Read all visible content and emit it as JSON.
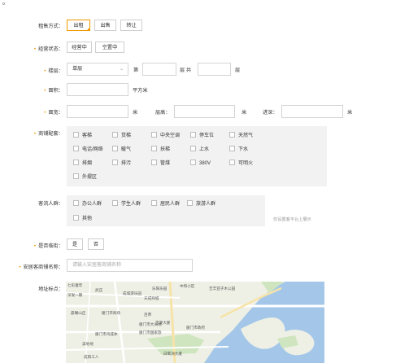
{
  "top_mark": "。",
  "rent_mode": {
    "label": "租售方式：",
    "options": [
      "出租",
      "出售",
      "转让"
    ],
    "selected": 0
  },
  "business_status": {
    "label": "经营状态：",
    "options": [
      "经营中",
      "空置中"
    ]
  },
  "floor": {
    "label": "楼层：",
    "select_value": "单层",
    "di": "第",
    "ceng_gong": "层 共",
    "ceng": "层"
  },
  "area": {
    "label": "面积：",
    "unit": "平方米"
  },
  "dims": {
    "width_label": "面宽：",
    "unit1": "米",
    "height_label": "层高：",
    "unit2": "米",
    "depth_label": "进深：",
    "unit3": "米"
  },
  "facilities": {
    "label": "商铺配套：",
    "items": [
      "客梯",
      "货梯",
      "中央空调",
      "停车位",
      "天然气",
      "电话/网络",
      "暖气",
      "扶梯",
      "上水",
      "下水",
      "排烟",
      "排污",
      "管煤",
      "380V",
      "可明火",
      "外摆区"
    ]
  },
  "customers": {
    "label": "客流人群：",
    "items": [
      "办公人群",
      "学生人群",
      "居民人群",
      "旅游人群",
      "其他"
    ],
    "note": "仅设置客平台上展示"
  },
  "street": {
    "label": "是否临街：",
    "options": [
      "是",
      "否"
    ]
  },
  "shop_name": {
    "label": "安居客商铺名称：",
    "placeholder": "请输入安居客商铺名称"
  },
  "location": {
    "label": "地址标点：",
    "map_labels": [
      "七彩童年",
      "武庄",
      "成城游乐园",
      "乐阳乐园",
      "深发一期",
      "中和小区",
      "天成商城",
      "吉丰亚子木公园",
      "晨曦山庄",
      "厦门市商场",
      "吕恭",
      "厦门市鸿成体",
      "厦门市国家旅",
      "吉厦大厦",
      "厦门市大洲地",
      "厦门市政府",
      "白鹭洲大厦",
      "美地地",
      "成阳工人"
    ]
  }
}
